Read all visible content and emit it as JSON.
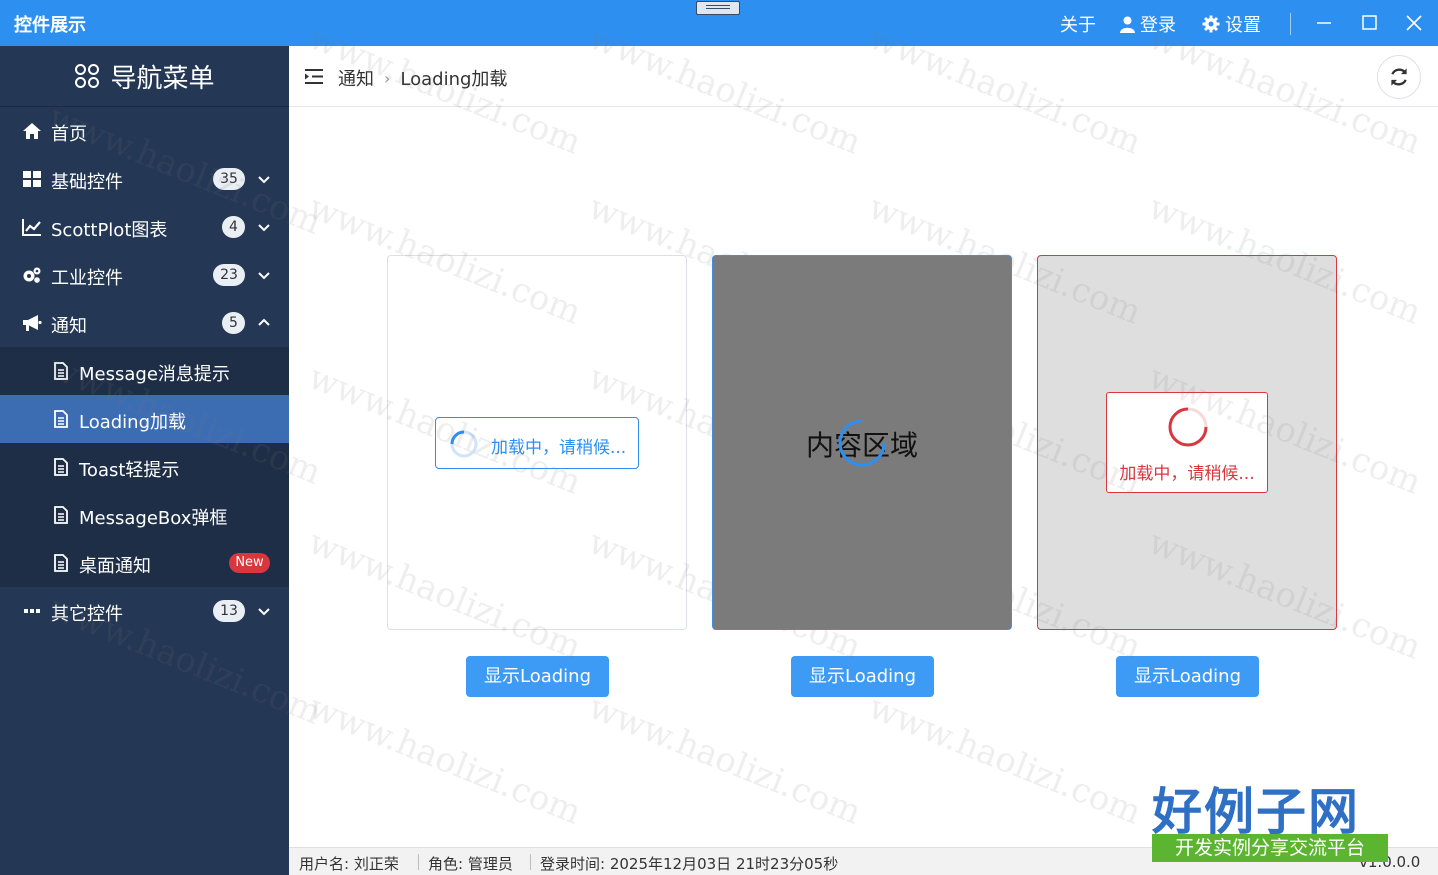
{
  "window": {
    "title": "控件展示",
    "menu": {
      "about": "关于",
      "login": "登录",
      "settings": "设置"
    }
  },
  "sidebar": {
    "title": "导航菜单",
    "items": [
      {
        "label": "首页",
        "icon": "home-icon"
      },
      {
        "label": "基础控件",
        "badge": "35",
        "icon": "grid-icon"
      },
      {
        "label": "ScottPlot图表",
        "badge": "4",
        "icon": "chart-line-icon"
      },
      {
        "label": "工业控件",
        "badge": "23",
        "icon": "gears-icon"
      },
      {
        "label": "通知",
        "badge": "5",
        "icon": "bullhorn-icon",
        "expanded": true
      },
      {
        "label": "Message消息提示",
        "icon": "document-icon"
      },
      {
        "label": "Loading加载",
        "icon": "document-icon",
        "active": true
      },
      {
        "label": "Toast轻提示",
        "icon": "document-icon"
      },
      {
        "label": "MessageBox弹框",
        "icon": "document-icon"
      },
      {
        "label": "桌面通知",
        "tag": "New",
        "icon": "document-icon"
      },
      {
        "label": "其它控件",
        "badge": "13",
        "icon": "ellipsis-icon"
      }
    ]
  },
  "breadcrumb": {
    "parent": "通知",
    "current": "Loading加载"
  },
  "panels": {
    "loading_text": "加载中，请稍候...",
    "content_text": "内容区域",
    "button_label": "显示Loading"
  },
  "status": {
    "user": "用户名: 刘正荣",
    "role": "角色: 管理员",
    "login_time": "登录时间: 2025年12月03日 21时23分05秒",
    "version": "v1.0.0.0"
  },
  "watermark": "www.haolizi.com",
  "brand": {
    "name": "好例子网",
    "slogan": "开发实例分享交流平台"
  },
  "colors": {
    "accent": "#2d8ff0",
    "sidebar": "#243754",
    "active": "#3c6db3",
    "danger": "#d9363e",
    "button": "#3d9af5"
  }
}
